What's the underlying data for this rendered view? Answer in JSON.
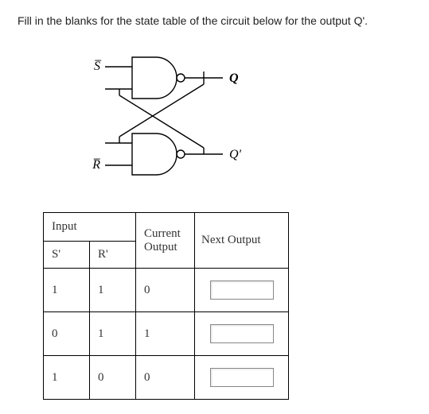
{
  "question": "Fill in the blanks for the state table of the circuit below for the output Q'.",
  "circuit": {
    "top_input": "S̅",
    "bottom_input": "R̅",
    "top_output": "Q",
    "bottom_output": "Q'"
  },
  "table": {
    "hdr_input": "Input",
    "hdr_s": "S'",
    "hdr_r": "R'",
    "hdr_current": "Current Output",
    "hdr_next": "Next Output",
    "rows": [
      {
        "s": "1",
        "r": "1",
        "current": "0",
        "next": ""
      },
      {
        "s": "0",
        "r": "1",
        "current": "1",
        "next": ""
      },
      {
        "s": "1",
        "r": "0",
        "current": "0",
        "next": ""
      }
    ]
  }
}
